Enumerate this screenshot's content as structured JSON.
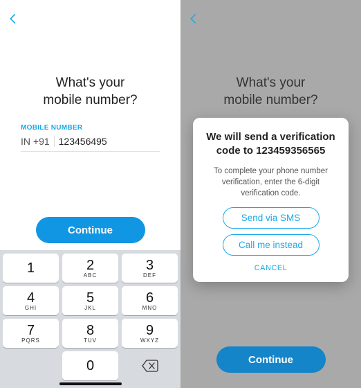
{
  "left": {
    "title_line1": "What's your",
    "title_line2": "mobile number?",
    "field_label": "MOBILE NUMBER",
    "country_prefix": "IN +91",
    "phone_value": "123456495",
    "continue_label": "Continue",
    "keypad": {
      "k1": {
        "num": "1",
        "sub": ""
      },
      "k2": {
        "num": "2",
        "sub": "ABC"
      },
      "k3": {
        "num": "3",
        "sub": "DEF"
      },
      "k4": {
        "num": "4",
        "sub": "GHI"
      },
      "k5": {
        "num": "5",
        "sub": "JKL"
      },
      "k6": {
        "num": "6",
        "sub": "MNO"
      },
      "k7": {
        "num": "7",
        "sub": "PQRS"
      },
      "k8": {
        "num": "8",
        "sub": "TUV"
      },
      "k9": {
        "num": "9",
        "sub": "WXYZ"
      },
      "k0": {
        "num": "0",
        "sub": ""
      }
    }
  },
  "right": {
    "title_line1": "What's your",
    "title_line2": "mobile number?",
    "modal": {
      "title_line1": "We will send a verification",
      "title_line2": "code to 123459356565",
      "body": "To complete your phone number verification, enter the 6-digit verification code.",
      "sms_label": "Send via SMS",
      "call_label": "Call me instead",
      "cancel_label": "CANCEL"
    },
    "continue_label": "Continue"
  },
  "colors": {
    "accent": "#1aa9e8"
  }
}
